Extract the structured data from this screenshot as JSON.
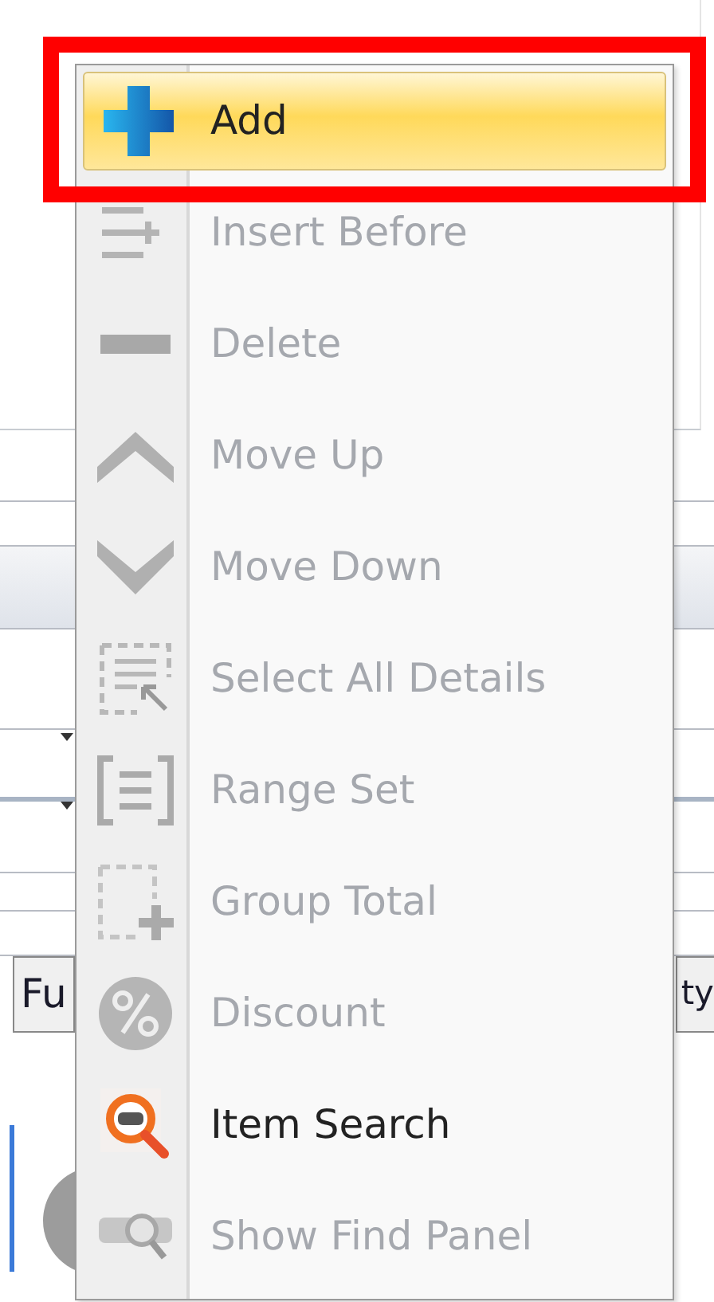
{
  "grid_header": [
    {
      "label": "Fu"
    },
    {
      "label": "ty"
    }
  ],
  "context_menu": {
    "items": [
      {
        "label": "Add",
        "disabled": false,
        "selected": true,
        "callout": true
      },
      {
        "label": "Insert Before",
        "disabled": true,
        "selected": false,
        "callout": false
      },
      {
        "label": "Delete",
        "disabled": true,
        "selected": false,
        "callout": false
      },
      {
        "label": "Move Up",
        "disabled": true,
        "selected": false,
        "callout": false
      },
      {
        "label": "Move Down",
        "disabled": true,
        "selected": false,
        "callout": false
      },
      {
        "label": "Select All Details",
        "disabled": true,
        "selected": false,
        "callout": false
      },
      {
        "label": "Range Set",
        "disabled": true,
        "selected": false,
        "callout": false
      },
      {
        "label": "Group Total",
        "disabled": true,
        "selected": false,
        "callout": false
      },
      {
        "label": "Discount",
        "disabled": true,
        "selected": false,
        "callout": false
      },
      {
        "label": "Item Search",
        "disabled": false,
        "selected": false,
        "callout": false
      },
      {
        "label": "Show Find Panel",
        "disabled": true,
        "selected": false,
        "callout": false
      }
    ]
  }
}
